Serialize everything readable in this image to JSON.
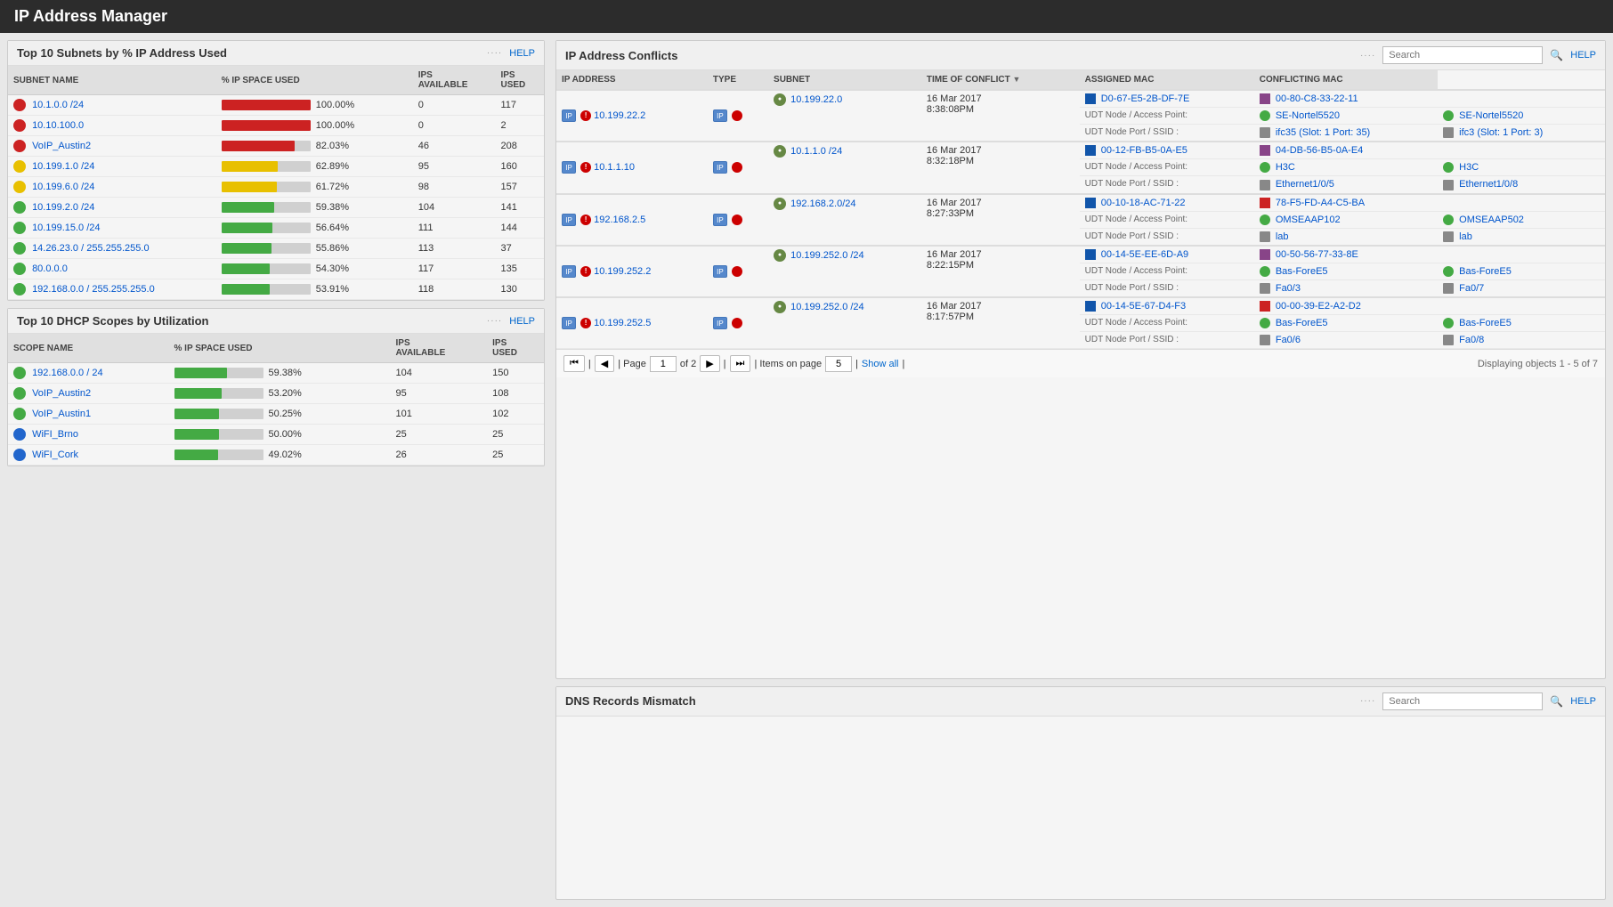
{
  "pageTitle": "IP Address Manager",
  "leftPanel": {
    "topWidget": {
      "title": "Top 10 Subnets by % IP Address Used",
      "helpLabel": "HELP",
      "columns": [
        "SUBNET NAME",
        "% IP SPACE USED",
        "IPS AVAILABLE",
        "IPS USED"
      ],
      "rows": [
        {
          "icon": "red",
          "name": "10.1.0.0 /24",
          "pct": "100.00%",
          "barPct": 100,
          "barColor": "red",
          "avail": "0",
          "used": "117"
        },
        {
          "icon": "red",
          "name": "10.10.100.0",
          "pct": "100.00%",
          "barPct": 100,
          "barColor": "red",
          "avail": "0",
          "used": "2"
        },
        {
          "icon": "red",
          "name": "VoIP_Austin2",
          "pct": "82.03%",
          "barPct": 82,
          "barColor": "red",
          "avail": "46",
          "used": "208"
        },
        {
          "icon": "yellow",
          "name": "10.199.1.0 /24",
          "pct": "62.89%",
          "barPct": 63,
          "barColor": "yellow",
          "avail": "95",
          "used": "160"
        },
        {
          "icon": "yellow",
          "name": "10.199.6.0 /24",
          "pct": "61.72%",
          "barPct": 62,
          "barColor": "yellow",
          "avail": "98",
          "used": "157"
        },
        {
          "icon": "green",
          "name": "10.199.2.0 /24",
          "pct": "59.38%",
          "barPct": 59,
          "barColor": "green",
          "avail": "104",
          "used": "141"
        },
        {
          "icon": "green",
          "name": "10.199.15.0 /24",
          "pct": "56.64%",
          "barPct": 57,
          "barColor": "green",
          "avail": "111",
          "used": "144"
        },
        {
          "icon": "green",
          "name": "14.26.23.0 / 255.255.255.0",
          "pct": "55.86%",
          "barPct": 56,
          "barColor": "green",
          "avail": "113",
          "used": "37"
        },
        {
          "icon": "green",
          "name": "80.0.0.0",
          "pct": "54.30%",
          "barPct": 54,
          "barColor": "green",
          "avail": "117",
          "used": "135"
        },
        {
          "icon": "green",
          "name": "192.168.0.0 / 255.255.255.0",
          "pct": "53.91%",
          "barPct": 54,
          "barColor": "green",
          "avail": "118",
          "used": "130"
        }
      ]
    },
    "bottomWidget": {
      "title": "Top 10 DHCP Scopes by Utilization",
      "helpLabel": "HELP",
      "columns": [
        "SCOPE NAME",
        "% IP SPACE USED",
        "IPS AVAILABLE",
        "IPS USED"
      ],
      "rows": [
        {
          "icon": "green",
          "name": "192.168.0.0 / 24",
          "pct": "59.38%",
          "barPct": 59,
          "barColor": "green",
          "avail": "104",
          "used": "150"
        },
        {
          "icon": "green",
          "name": "VoIP_Austin2",
          "pct": "53.20%",
          "barPct": 53,
          "barColor": "green",
          "avail": "95",
          "used": "108"
        },
        {
          "icon": "green",
          "name": "VoIP_Austin1",
          "pct": "50.25%",
          "barPct": 50,
          "barColor": "green",
          "avail": "101",
          "used": "102"
        },
        {
          "icon": "blue",
          "name": "WiFI_Brno",
          "pct": "50.00%",
          "barPct": 50,
          "barColor": "green",
          "avail": "25",
          "used": "25"
        },
        {
          "icon": "blue",
          "name": "WiFI_Cork",
          "pct": "49.02%",
          "barPct": 49,
          "barColor": "green",
          "avail": "26",
          "used": "25"
        }
      ]
    }
  },
  "rightPanel": {
    "conflictsWidget": {
      "title": "IP Address Conflicts",
      "searchPlaceholder": "Search",
      "helpLabel": "HELP",
      "columns": [
        {
          "key": "ipAddress",
          "label": "IP ADDRESS"
        },
        {
          "key": "type",
          "label": "TYPE"
        },
        {
          "key": "subnet",
          "label": "SUBNET"
        },
        {
          "key": "timeOfConflict",
          "label": "TIME OF CONFLICT"
        },
        {
          "key": "assignedMac",
          "label": "ASSIGNED MAC"
        },
        {
          "key": "conflictingMac",
          "label": "CONFLICTING MAC"
        }
      ],
      "rows": [
        {
          "ip": "10.199.22.2",
          "subnet": "10.199.22.0",
          "timeDate": "16 Mar 2017",
          "timeHour": "8:38:08PM",
          "assignedMac": "D0-67-E5-2B-DF-7E",
          "assignedNode1": "SE-Nortel5520",
          "assignedNode2": "ifc35 (Slot: 1 Port: 35)",
          "conflictingMac": "00-80-C8-33-22-11",
          "conflictingNode1": "SE-Nortel5520",
          "conflictingNode2": "ifc3 (Slot: 1 Port: 3)",
          "assignedMacColor": "blue",
          "conflictingMacColor": "purple"
        },
        {
          "ip": "10.1.1.10",
          "subnet": "10.1.1.0 /24",
          "timeDate": "16 Mar 2017",
          "timeHour": "8:32:18PM",
          "assignedMac": "00-12-FB-B5-0A-E5",
          "assignedNode1": "H3C",
          "assignedNode2": "Ethernet1/0/5",
          "conflictingMac": "04-DB-56-B5-0A-E4",
          "conflictingNode1": "H3C",
          "conflictingNode2": "Ethernet1/0/8",
          "assignedMacColor": "blue",
          "conflictingMacColor": "purple"
        },
        {
          "ip": "192.168.2.5",
          "subnet": "192.168.2.0/24",
          "timeDate": "16 Mar 2017",
          "timeHour": "8:27:33PM",
          "assignedMac": "00-10-18-AC-71-22",
          "assignedNode1": "OMSEAAP102",
          "assignedNode2": "lab",
          "conflictingMac": "78-F5-FD-A4-C5-BA",
          "conflictingNode1": "OMSEAAP502",
          "conflictingNode2": "lab",
          "assignedMacColor": "blue",
          "conflictingMacColor": "red"
        },
        {
          "ip": "10.199.252.2",
          "subnet": "10.199.252.0 /24",
          "timeDate": "16 Mar 2017",
          "timeHour": "8:22:15PM",
          "assignedMac": "00-14-5E-EE-6D-A9",
          "assignedNode1": "Bas-ForeE5",
          "assignedNode2": "Fa0/3",
          "conflictingMac": "00-50-56-77-33-8E",
          "conflictingNode1": "Bas-ForeE5",
          "conflictingNode2": "Fa0/7",
          "assignedMacColor": "blue",
          "conflictingMacColor": "purple"
        },
        {
          "ip": "10.199.252.5",
          "subnet": "10.199.252.0 /24",
          "timeDate": "16 Mar 2017",
          "timeHour": "8:17:57PM",
          "assignedMac": "00-14-5E-67-D4-F3",
          "assignedNode1": "Bas-ForeE5",
          "assignedNode2": "Fa0/6",
          "conflictingMac": "00-00-39-E2-A2-D2",
          "conflictingNode1": "Bas-ForeE5",
          "conflictingNode2": "Fa0/8",
          "assignedMacColor": "blue",
          "conflictingMacColor": "red"
        }
      ],
      "pagination": {
        "page": "1",
        "totalPages": "2",
        "itemsPerPage": "5",
        "showAll": "Show all",
        "displayInfo": "Displaying objects 1 - 5 of 7"
      }
    },
    "dnsWidget": {
      "title": "DNS Records Mismatch",
      "searchPlaceholder": "Search",
      "helpLabel": "HELP"
    }
  }
}
